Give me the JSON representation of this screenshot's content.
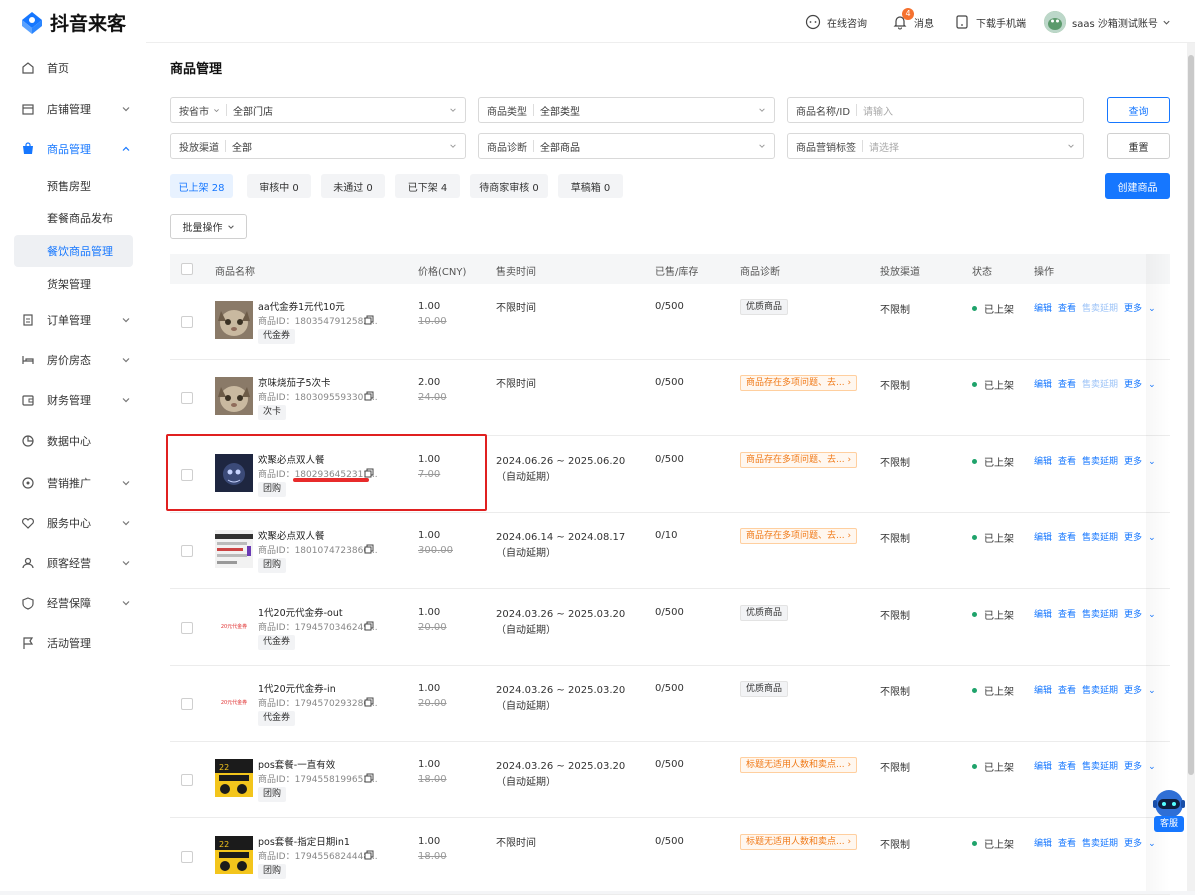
{
  "app": {
    "name": "抖音来客"
  },
  "topbar": {
    "consult_label": "在线咨询",
    "message_label": "消息",
    "message_badge": "4",
    "download_label": "下载手机端",
    "account_label": "saas 沙箱测试账号"
  },
  "sidebar": {
    "items": [
      {
        "label": "首页",
        "icon": "home-icon"
      },
      {
        "label": "店铺管理",
        "icon": "store-icon"
      },
      {
        "label": "商品管理",
        "icon": "bag-icon"
      },
      {
        "label": "订单管理",
        "icon": "clipboard-icon"
      },
      {
        "label": "房价房态",
        "icon": "bed-icon"
      },
      {
        "label": "财务管理",
        "icon": "wallet-icon"
      },
      {
        "label": "数据中心",
        "icon": "pie-chart-icon"
      },
      {
        "label": "营销推广",
        "icon": "target-icon"
      },
      {
        "label": "服务中心",
        "icon": "heart-icon"
      },
      {
        "label": "顾客经营",
        "icon": "user-icon"
      },
      {
        "label": "经营保障",
        "icon": "shield-icon"
      },
      {
        "label": "活动管理",
        "icon": "flag-icon"
      }
    ],
    "sub_items": [
      "预售房型",
      "套餐商品发布",
      "餐饮商品管理",
      "货架管理"
    ]
  },
  "page": {
    "title": "商品管理"
  },
  "filters": {
    "store_scope": "按省市",
    "store_value": "全部门店",
    "type_label": "商品类型",
    "type_value": "全部类型",
    "name_label": "商品名称/ID",
    "name_placeholder": "请输入",
    "channel_label": "投放渠道",
    "channel_value": "全部",
    "diag_label": "商品诊断",
    "diag_value": "全部商品",
    "tag_label": "商品营销标签",
    "tag_placeholder": "请选择",
    "query_button": "查询",
    "reset_button": "重置"
  },
  "tabs": [
    {
      "label": "已上架 28"
    },
    {
      "label": "审核中 0"
    },
    {
      "label": "未通过 0"
    },
    {
      "label": "已下架 4"
    },
    {
      "label": "待商家审核 0"
    },
    {
      "label": "草稿箱 0"
    }
  ],
  "create_button": "创建商品",
  "batch_button": "批量操作",
  "table": {
    "headers": [
      "商品名称",
      "价格(CNY)",
      "售卖时间",
      "已售/库存",
      "商品诊断",
      "投放渠道",
      "状态",
      "操作"
    ],
    "ops": {
      "edit": "编辑",
      "view": "查看",
      "extend": "售卖延期",
      "more": "更多"
    },
    "rows": [
      {
        "name": "aa代金券1元代10元",
        "id": "商品ID：1803547912582...",
        "tag": "代金券",
        "price": "1.00",
        "orig": "10.00",
        "time": "不限时间",
        "stock": "0/500",
        "diag": "优质商品",
        "diag_type": "good",
        "channel": "不限制",
        "status": "已上架",
        "thumb": "cat"
      },
      {
        "name": "京味烧茄子5次卡",
        "id": "商品ID：1803095593301...",
        "tag": "次卡",
        "price": "2.00",
        "orig": "24.00",
        "time": "不限时间",
        "stock": "0/500",
        "diag": "商品存在多项问题、去...",
        "diag_type": "warn",
        "channel": "不限制",
        "status": "已上架",
        "thumb": "cat"
      },
      {
        "name": "欢聚必点双人餐",
        "id": "商品ID：1802936452311...",
        "tag": "团购",
        "price": "1.00",
        "orig": "7.00",
        "time": "2024.06.26 ~ 2025.06.20 （自动延期）",
        "stock": "0/500",
        "diag": "商品存在多项问题、去...",
        "diag_type": "warn",
        "channel": "不限制",
        "status": "已上架",
        "thumb": "dark"
      },
      {
        "name": "欢聚必点双人餐",
        "id": "商品ID：1801074723866...",
        "tag": "团购",
        "price": "1.00",
        "orig": "300.00",
        "time": "2024.06.14 ~ 2024.08.17 （自动延期）",
        "stock": "0/10",
        "diag": "商品存在多项问题、去...",
        "diag_type": "warn",
        "channel": "不限制",
        "status": "已上架",
        "thumb": "screen"
      },
      {
        "name": "1代20元代金券-out",
        "id": "商品ID：1794570346249...",
        "tag": "代金券",
        "price": "1.00",
        "orig": "20.00",
        "time": "2024.03.26 ~ 2025.03.20 （自动延期）",
        "stock": "0/500",
        "diag": "优质商品",
        "diag_type": "good",
        "channel": "不限制",
        "status": "已上架",
        "thumb": "voucher",
        "thumb_text": "20元代金券"
      },
      {
        "name": "1代20元代金券-in",
        "id": "商品ID：1794570293286...",
        "tag": "代金券",
        "price": "1.00",
        "orig": "20.00",
        "time": "2024.03.26 ~ 2025.03.20 （自动延期）",
        "stock": "0/500",
        "diag": "优质商品",
        "diag_type": "good",
        "channel": "不限制",
        "status": "已上架",
        "thumb": "voucher",
        "thumb_text": "20元代金券"
      },
      {
        "name": "pos套餐-一直有效",
        "id": "商品ID：1794558199653...",
        "tag": "团购",
        "price": "1.00",
        "orig": "18.00",
        "time": "2024.03.26 ~ 2025.03.20 （自动延期）",
        "stock": "0/500",
        "diag": "标题无适用人数和卖点...",
        "diag_type": "warn",
        "channel": "不限制",
        "status": "已上架",
        "thumb": "poster"
      },
      {
        "name": "pos套餐-指定日期in1",
        "id": "商品ID：1794556824448...",
        "tag": "团购",
        "price": "1.00",
        "orig": "18.00",
        "time": "不限时间",
        "stock": "0/500",
        "diag": "标题无适用人数和卖点...",
        "diag_type": "warn",
        "channel": "不限制",
        "status": "已上架",
        "thumb": "poster"
      }
    ]
  },
  "service": {
    "label": "客服"
  },
  "colors": {
    "accent": "#1677ff",
    "status_green": "#1fa36b",
    "warn_orange": "#f07a18",
    "highlight_red": "#e02020"
  }
}
